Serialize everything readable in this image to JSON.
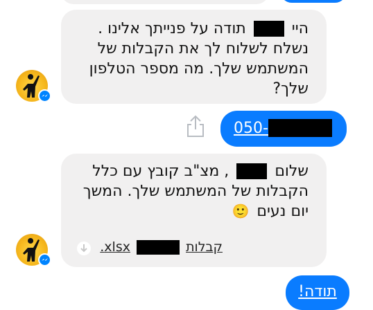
{
  "colors": {
    "incoming_bubble": "#f1f0f0",
    "outgoing_bubble": "#0a7cff",
    "messenger_badge": "#0084ff",
    "avatar_background": "#f6b81e"
  },
  "messages": [
    {
      "direction": "incoming",
      "lines": [
        {
          "before": "היי",
          "after": "תודה על פנייתך אלינו ."
        },
        {
          "text": "נשלח לשלוח לך את הקבלות של"
        },
        {
          "text": "המשתמש שלך. מה מספר הטלפון"
        },
        {
          "text": "שלך?"
        }
      ]
    },
    {
      "direction": "outgoing",
      "text_prefix": "050-",
      "redacted": true
    },
    {
      "direction": "incoming",
      "lines": [
        {
          "before": "שלום",
          "after": ", מצ\"ב קובץ עם כלל"
        },
        {
          "text": "הקבלות של המשתמש שלך. המשך"
        },
        {
          "text": "יום נעים",
          "emoji": "🙂"
        }
      ],
      "attachment": {
        "prefix": "קבלות",
        "extension": "xlsx.",
        "icon": "download-icon"
      }
    },
    {
      "direction": "outgoing",
      "text": "תודה!"
    }
  ],
  "icons": {
    "share": "share-icon",
    "avatar_badge": "messenger-icon"
  }
}
